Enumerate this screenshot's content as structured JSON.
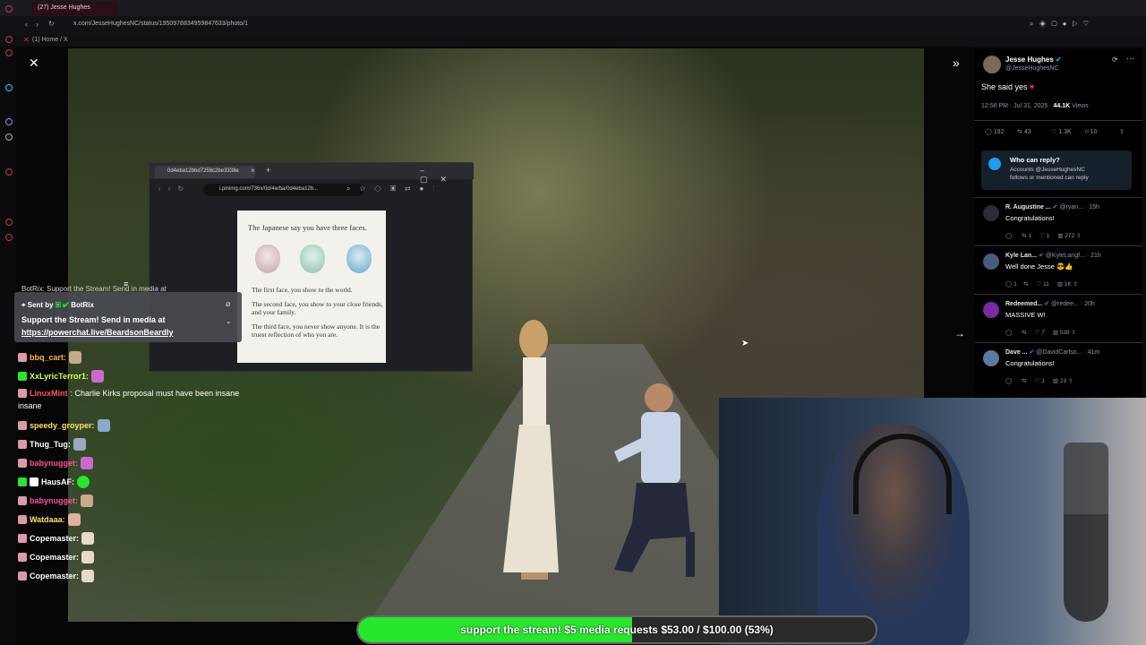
{
  "browser": {
    "tab_title": "(27) Jesse Hughes",
    "url": "x.com/JesseHughesNC/status/1950978834959847633/photo/1",
    "bookmark": "(1) Home / X"
  },
  "popup": {
    "tab_title": "0d4eba12bbd7258c2be3338e",
    "address": "i.pinimg.com/736x/0d/4e/ba/0d4eba12b...",
    "meme": {
      "title": "The Japanese say you have three faces.",
      "line1": "The first face, you show to the world.",
      "line2": "The second face, you show to your close friends, and your family.",
      "line3": "The third face, you never show anyone. It is the truest reflection of who you are."
    }
  },
  "pinned": {
    "header": "BotRix: Support the Stream! Send in media at",
    "sent_by": "Sent by",
    "sender": "BotRix",
    "message": "Support the Stream! Send in media at",
    "link": "https://powerchat.live/BeardsonBeardly"
  },
  "chat": [
    {
      "user": "bbq_cart:",
      "msg": "",
      "color": "#ffb347"
    },
    {
      "user": "XxLyricTerror1:",
      "msg": "",
      "color": "#d6ff5c"
    },
    {
      "user": "LinuxMint",
      "msg": ": Charlie Kirks proposal must have been insane",
      "color": "#ff4f5e"
    },
    {
      "user": "speedy_groyper:",
      "msg": "",
      "color": "#ffe066"
    },
    {
      "user": "Thug_Tug:",
      "msg": "",
      "color": "#ffffff"
    },
    {
      "user": "babynugget:",
      "msg": "",
      "color": "#ff4fa3"
    },
    {
      "user": "HausAF:",
      "msg": "",
      "color": "#ffffff"
    },
    {
      "user": "babynugget:",
      "msg": "",
      "color": "#ff4fa3"
    },
    {
      "user": "Watdaaa:",
      "msg": "",
      "color": "#ffe066"
    },
    {
      "user": "Copemaster:",
      "msg": "",
      "color": "#ffffff"
    },
    {
      "user": "Copemaster:",
      "msg": "",
      "color": "#ffffff"
    },
    {
      "user": "Copemaster:",
      "msg": "",
      "color": "#ffffff"
    }
  ],
  "tweet": {
    "name": "Jesse Hughes",
    "handle": "@JesseHughesNC",
    "text": "She said yes",
    "meta": "12:56 PM · Jul 31, 2025 · ",
    "views_num": "44.1K",
    "views_label": " Views",
    "replies": "192",
    "retweets": "43",
    "likes": "1.3K",
    "bookmarks": "10",
    "who_can_reply_title": "Who can reply?",
    "who_can_reply_text1": "Accounts @JesseHughesNC",
    "who_can_reply_text2": "follows or mentioned can reply"
  },
  "replies": [
    {
      "name": "R. Augustine ...",
      "handle": "@ryan...",
      "time": "· 15h",
      "text": "Congratulations!",
      "r": "",
      "rt": "1",
      "l": "1",
      "v": "272",
      "color": "#2b2b3a"
    },
    {
      "name": "Kyle Lan...",
      "handle": "@KyleLangf...",
      "time": "· 21h",
      "text": "Well done Jesse 😎👍",
      "r": "1",
      "rt": "",
      "l": "11",
      "v": "1K",
      "color": "#4a5a7a"
    },
    {
      "name": "Redeemed...",
      "handle": "@redee...",
      "time": "· 20h",
      "text": "MASSIVE W!",
      "r": "",
      "rt": "",
      "l": "7",
      "v": "539",
      "color": "#7a2aa0"
    },
    {
      "name": "Dave ...",
      "handle": "@DavidCarlso...",
      "time": "· 41m",
      "text": "Congratulations!",
      "r": "",
      "rt": "",
      "l": "1",
      "v": "23",
      "color": "#5a7aa0"
    }
  ],
  "progress": {
    "label": "support the stream! $5 media requests $53.00 / $100.00 (53%)",
    "percent": 53
  }
}
